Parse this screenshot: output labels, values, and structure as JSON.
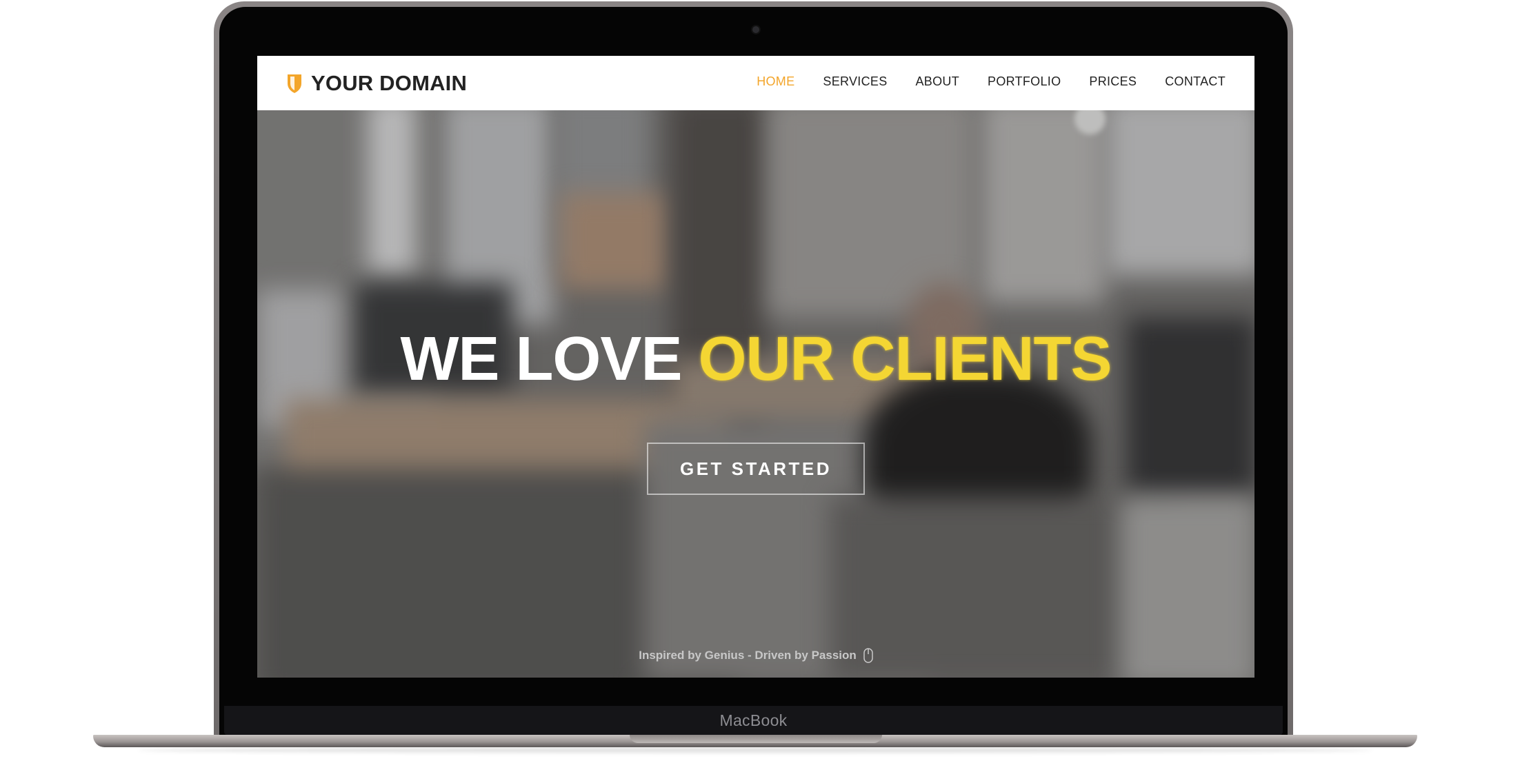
{
  "device": {
    "label": "MacBook"
  },
  "site": {
    "brand": "YOUR DOMAIN",
    "brand_icon": "shield-icon",
    "accent_color": "#f3a52a",
    "nav": [
      {
        "label": "HOME",
        "active": true
      },
      {
        "label": "SERVICES",
        "active": false
      },
      {
        "label": "ABOUT",
        "active": false
      },
      {
        "label": "PORTFOLIO",
        "active": false
      },
      {
        "label": "PRICES",
        "active": false
      },
      {
        "label": "CONTACT",
        "active": false
      }
    ]
  },
  "hero": {
    "headline_white": "WE LOVE",
    "headline_yellow": "OUR CLIENTS",
    "headline_yellow_color": "#f4d633",
    "cta_label": "GET STARTED",
    "tagline": "Inspired by Genius - Driven by Passion",
    "scroll_icon": "mouse-icon"
  }
}
